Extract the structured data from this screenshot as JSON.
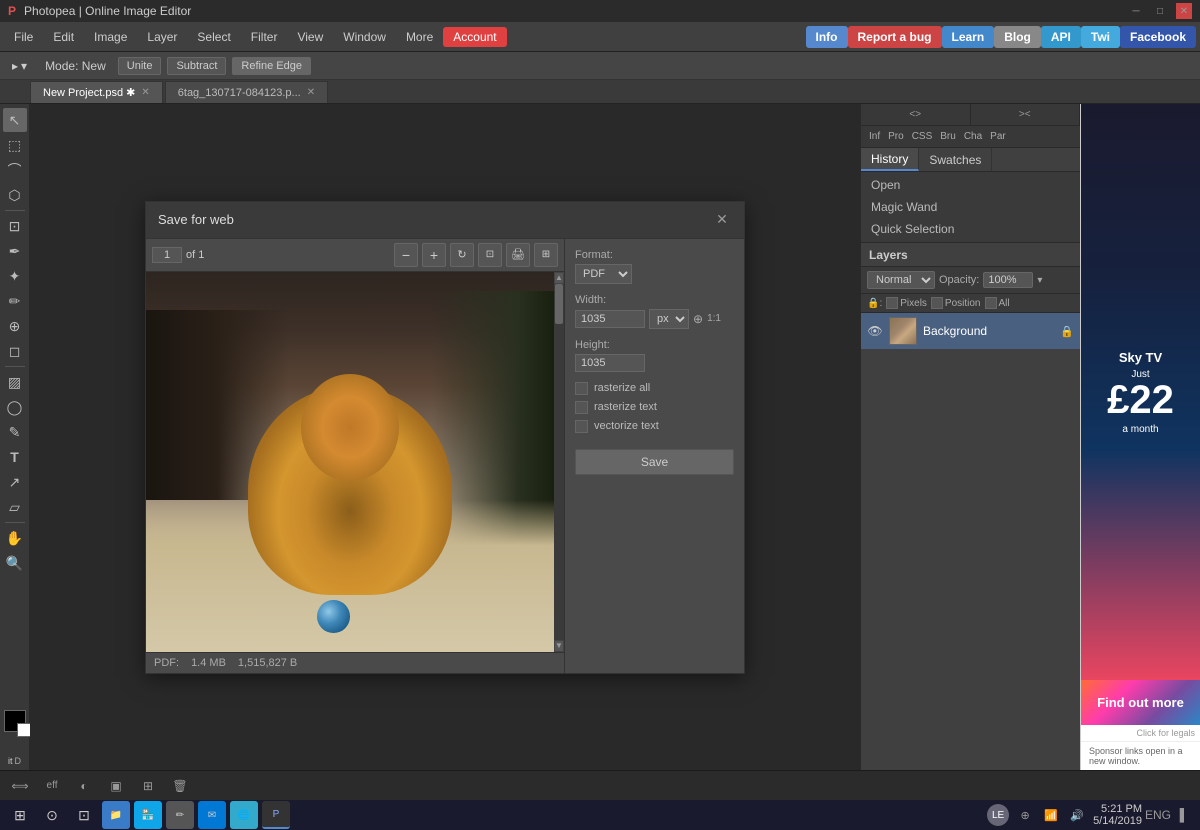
{
  "titlebar": {
    "title": "Photopea | Online Image Editor",
    "minimize": "─",
    "maximize": "□",
    "close": "✕"
  },
  "menubar": {
    "items": [
      "File",
      "Edit",
      "Image",
      "Layer",
      "Select",
      "Filter",
      "View",
      "Window",
      "More"
    ],
    "account_label": "Account",
    "nav_items": [
      {
        "label": "Info",
        "class": "info"
      },
      {
        "label": "Report a bug",
        "class": "bug"
      },
      {
        "label": "Learn",
        "class": "learn"
      },
      {
        "label": "Blog",
        "class": "blog"
      },
      {
        "label": "API",
        "class": "api"
      },
      {
        "label": "Twi",
        "class": "twi"
      },
      {
        "label": "Facebook",
        "class": "facebook"
      }
    ]
  },
  "toolbar": {
    "mode_label": "Mode:",
    "mode_value": "New",
    "unite_label": "Unite",
    "subtract_label": "Subtract",
    "refine_edge_label": "Refine Edge"
  },
  "tabs": [
    {
      "label": "New Project.psd",
      "active": true,
      "closable": true
    },
    {
      "label": "6tag_130717-084123.p...",
      "active": false,
      "closable": true
    }
  ],
  "panel": {
    "nav": [
      "<>",
      "><"
    ],
    "shortcuts": [
      "Inf",
      "Pro",
      "CSS",
      "Bru",
      "Cha",
      "Par"
    ],
    "tabs": [
      {
        "label": "History",
        "active": true
      },
      {
        "label": "Swatches",
        "active": false
      }
    ],
    "tools": [
      {
        "label": "Open"
      },
      {
        "label": "Magic Wand"
      },
      {
        "label": "Quick Selection"
      }
    ],
    "layers_header": "Layers",
    "blend_mode": "Normal",
    "opacity_label": "Opacity:",
    "opacity_value": "100%",
    "lock_label": "Lock:",
    "pixels_label": "Pixels",
    "position_label": "Position",
    "all_label": "All",
    "layer_name": "Background"
  },
  "dialog": {
    "title": "Save for web",
    "close": "✕",
    "page_current": "1",
    "page_total": "of 1",
    "format_label": "Format:",
    "format_value": "PDF",
    "width_label": "Width:",
    "width_value": "1035",
    "width_unit": "px",
    "height_label": "Height:",
    "height_value": "1035",
    "rasterize_all_label": "rasterize all",
    "rasterize_text_label": "rasterize text",
    "vectorize_text_label": "vectorize text",
    "save_label": "Save",
    "status_format": "PDF:",
    "status_size": "1.4 MB",
    "status_bytes": "1,515,827 B"
  },
  "ad": {
    "sky_label": "Sky TV",
    "just_label": "Just",
    "price": "£22",
    "month": "a month",
    "findout": "Find out more",
    "footer": "Click for legals",
    "sponsor": "Sponsor links open in a new window."
  },
  "statusbar": {
    "icons": [
      "⟺",
      "eff",
      "◐",
      "▣",
      "⊞",
      "🗑"
    ]
  },
  "taskbar": {
    "time": "5:21 PM",
    "date": "5/14/2019",
    "language": "ENG",
    "apps": [
      "⊞",
      "⊙",
      "⊡",
      "📁",
      "🏪",
      "⊕",
      "✉",
      "🌐"
    ]
  }
}
